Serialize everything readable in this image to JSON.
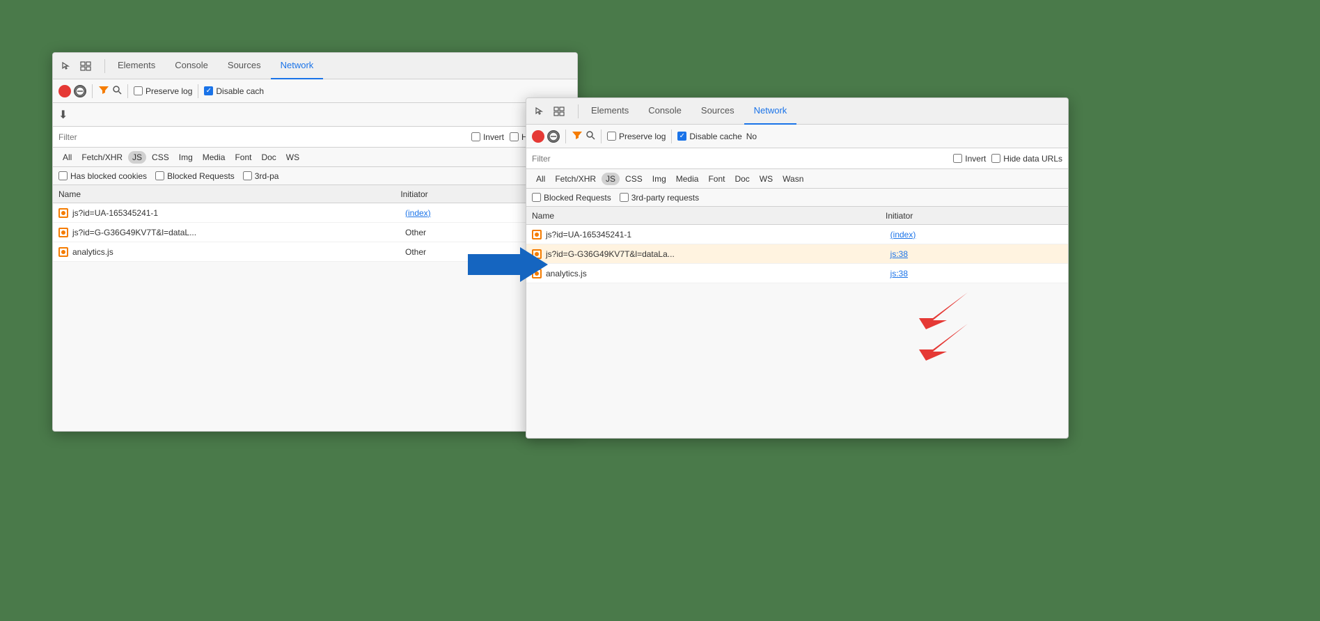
{
  "window1": {
    "tabs": [
      "Elements",
      "Console",
      "Sources",
      "Network"
    ],
    "active_tab": "Network",
    "toolbar": {
      "preserve_log_label": "Preserve log",
      "disable_cache_label": "Disable cach",
      "preserve_log_checked": false,
      "disable_cache_checked": true
    },
    "filter": {
      "placeholder": "Filter",
      "invert_label": "Invert",
      "hide_data_urls_label": "Hide data UR"
    },
    "type_filters": [
      "All",
      "Fetch/XHR",
      "JS",
      "CSS",
      "Img",
      "Media",
      "Font",
      "Doc",
      "WS"
    ],
    "active_type": "JS",
    "blocked_row": {
      "has_blocked_cookies": "Has blocked cookies",
      "blocked_requests": "Blocked Requests",
      "third_party": "3rd-pa"
    },
    "table": {
      "columns": [
        "Name",
        "Initiator"
      ],
      "rows": [
        {
          "name": "js?id=UA-165345241-1",
          "initiator": "(index)"
        },
        {
          "name": "js?id=G-G36G49KV7T&l=dataL...",
          "initiator": "Other"
        },
        {
          "name": "analytics.js",
          "initiator": "Other"
        }
      ]
    }
  },
  "window2": {
    "tabs": [
      "Elements",
      "Console",
      "Sources",
      "Network"
    ],
    "active_tab": "Network",
    "toolbar": {
      "preserve_log_label": "Preserve log",
      "disable_cache_label": "Disable cache",
      "no_label": "No",
      "preserve_log_checked": false,
      "disable_cache_checked": true
    },
    "filter": {
      "placeholder": "Filter",
      "invert_label": "Invert",
      "hide_data_urls_label": "Hide data URLs"
    },
    "type_filters": [
      "All",
      "Fetch/XHR",
      "JS",
      "CSS",
      "Img",
      "Media",
      "Font",
      "Doc",
      "WS",
      "Wasn"
    ],
    "active_type": "JS",
    "blocked_row": {
      "blocked_requests": "Blocked Requests",
      "third_party": "3rd-party requests"
    },
    "table": {
      "columns": [
        "Name",
        "Initiator"
      ],
      "rows": [
        {
          "name": "js?id=UA-165345241-1",
          "initiator": "(index)",
          "initiator_link": true
        },
        {
          "name": "js?id=G-G36G49KV7T&l=dataLa...",
          "initiator": "js:38",
          "initiator_link": true,
          "highlighted": true
        },
        {
          "name": "analytics.js",
          "initiator": "js:38",
          "initiator_link": true
        }
      ]
    }
  },
  "icons": {
    "cursor": "↖",
    "layers": "⧉",
    "filter": "▽",
    "search": "⌕",
    "clear": "⊘",
    "download": "⬇",
    "checkmark": "✓"
  }
}
